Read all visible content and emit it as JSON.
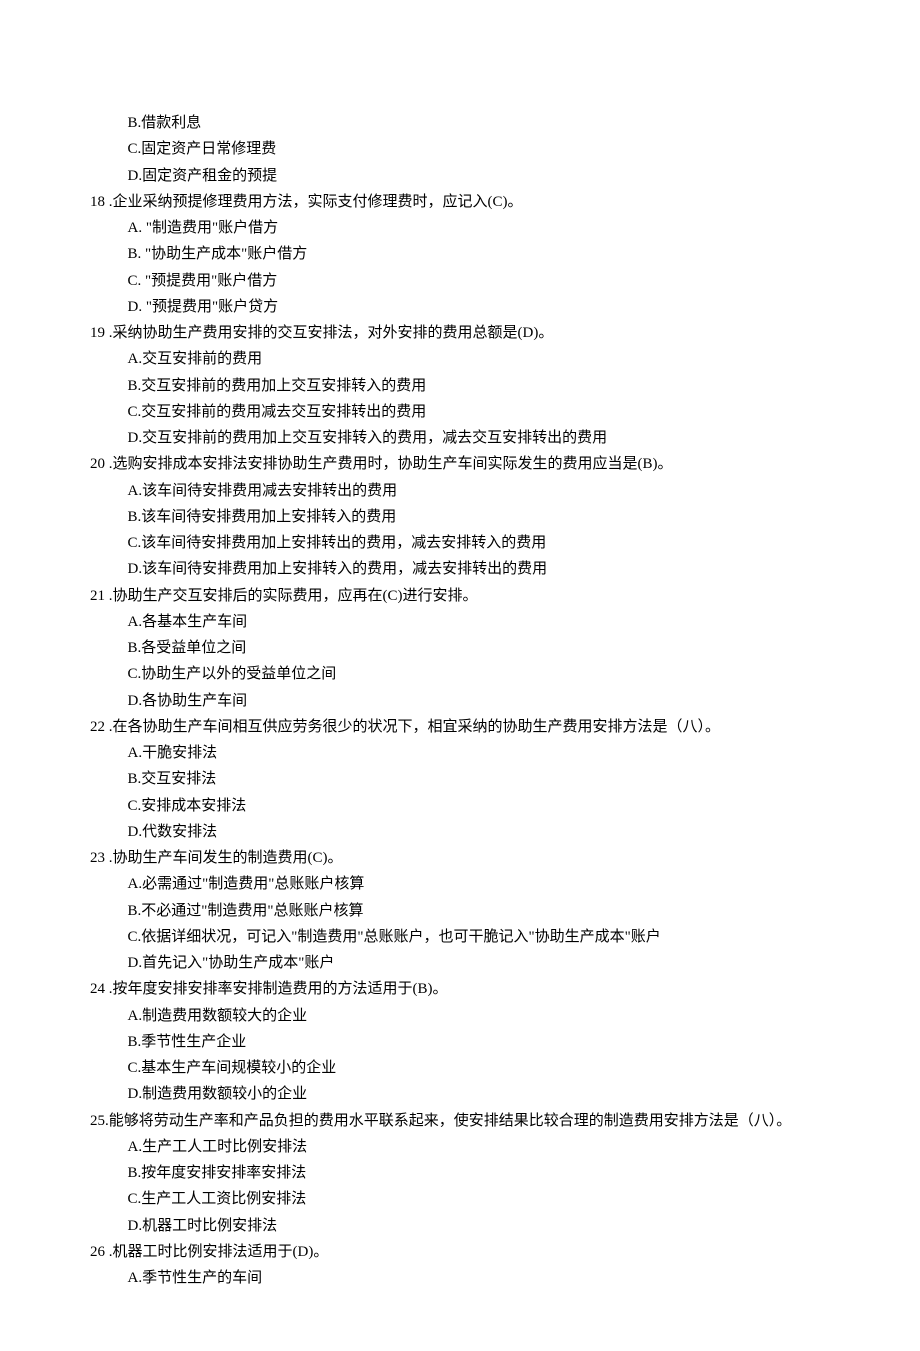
{
  "lines": [
    {
      "cls": "option",
      "text": "B.借款利息"
    },
    {
      "cls": "option",
      "text": "C.固定资产日常修理费"
    },
    {
      "cls": "option",
      "text": "D.固定资产租金的预提"
    },
    {
      "cls": "q",
      "text": "18 .企业采纳预提修理费用方法，实际支付修理费时，应记入(C)。"
    },
    {
      "cls": "option",
      "text": "A.  \"制造费用\"账户借方"
    },
    {
      "cls": "option",
      "text": "B.  \"协助生产成本\"账户借方"
    },
    {
      "cls": "option",
      "text": "C.  \"预提费用\"账户借方"
    },
    {
      "cls": "option",
      "text": "D.  \"预提费用\"账户贷方"
    },
    {
      "cls": "q",
      "text": "19 .采纳协助生产费用安排的交互安排法，对外安排的费用总额是(D)。"
    },
    {
      "cls": "option",
      "text": "A.交互安排前的费用"
    },
    {
      "cls": "option",
      "text": "B.交互安排前的费用加上交互安排转入的费用"
    },
    {
      "cls": "option",
      "text": "C.交互安排前的费用减去交互安排转出的费用"
    },
    {
      "cls": "option",
      "text": "D.交互安排前的费用加上交互安排转入的费用，减去交互安排转出的费用"
    },
    {
      "cls": "q",
      "text": "20 .选购安排成本安排法安排协助生产费用时，协助生产车间实际发生的费用应当是(B)。"
    },
    {
      "cls": "option",
      "text": "A.该车间待安排费用减去安排转出的费用"
    },
    {
      "cls": "option",
      "text": "B.该车间待安排费用加上安排转入的费用"
    },
    {
      "cls": "option",
      "text": "C.该车间待安排费用加上安排转出的费用，减去安排转入的费用"
    },
    {
      "cls": "option",
      "text": "D.该车间待安排费用加上安排转入的费用，减去安排转出的费用"
    },
    {
      "cls": "q",
      "text": "21 .协助生产交互安排后的实际费用，应再在(C)进行安排。"
    },
    {
      "cls": "option",
      "text": "A.各基本生产车间"
    },
    {
      "cls": "option",
      "text": "B.各受益单位之间"
    },
    {
      "cls": "option",
      "text": "C.协助生产以外的受益单位之间"
    },
    {
      "cls": "option",
      "text": "D.各协助生产车间"
    },
    {
      "cls": "q",
      "text": "22 .在各协助生产车间相互供应劳务很少的状况下，相宜采纳的协助生产费用安排方法是（八）。"
    },
    {
      "cls": "option",
      "text": "A.干脆安排法"
    },
    {
      "cls": "option",
      "text": "B.交互安排法"
    },
    {
      "cls": "option",
      "text": "C.安排成本安排法"
    },
    {
      "cls": "option",
      "text": "D.代数安排法"
    },
    {
      "cls": "q",
      "text": "23 .协助生产车间发生的制造费用(C)。"
    },
    {
      "cls": "option",
      "text": "A.必需通过\"制造费用\"总账账户核算"
    },
    {
      "cls": "option",
      "text": "B.不必通过\"制造费用\"总账账户核算"
    },
    {
      "cls": "option",
      "text": "C.依据详细状况，可记入\"制造费用\"总账账户，也可干脆记入\"协助生产成本\"账户"
    },
    {
      "cls": "option",
      "text": "D.首先记入\"协助生产成本\"账户"
    },
    {
      "cls": "q",
      "text": "24 .按年度安排安排率安排制造费用的方法适用于(B)。"
    },
    {
      "cls": "option",
      "text": "A.制造费用数额较大的企业"
    },
    {
      "cls": "option",
      "text": "B.季节性生产企业"
    },
    {
      "cls": "option",
      "text": "C.基本生产车间规模较小的企业"
    },
    {
      "cls": "option",
      "text": "D.制造费用数额较小的企业"
    },
    {
      "cls": "q",
      "text": "25.能够将劳动生产率和产品负担的费用水平联系起来，使安排结果比较合理的制造费用安排方法是（八）。"
    },
    {
      "cls": "option",
      "text": "A.生产工人工时比例安排法"
    },
    {
      "cls": "option",
      "text": "B.按年度安排安排率安排法"
    },
    {
      "cls": "option",
      "text": "C.生产工人工资比例安排法"
    },
    {
      "cls": "option",
      "text": "D.机器工时比例安排法"
    },
    {
      "cls": "q",
      "text": "26 .机器工时比例安排法适用于(D)。"
    },
    {
      "cls": "option",
      "text": "A.季节性生产的车间"
    }
  ]
}
